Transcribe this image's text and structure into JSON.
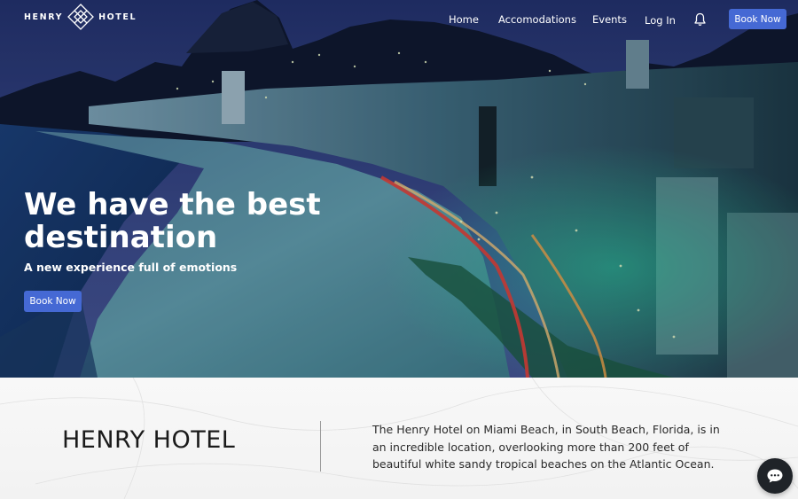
{
  "nav": {
    "logo_left": "HENRY",
    "logo_right": "HOTEL",
    "links": [
      "Home",
      "Accomodations",
      "Events",
      "Log In"
    ],
    "book_label": "Book Now"
  },
  "hero": {
    "title": "We have the best destination",
    "subtitle": "A new experience full of emotions",
    "book_label": "Book Now"
  },
  "about": {
    "title": "HENRY HOTEL",
    "text": "The Henry Hotel on Miami Beach, in South Beach, Florida, is in an incredible location, overlooking more than 200 feet of beautiful white sandy tropical beaches on the Atlantic Ocean."
  },
  "icons": {
    "logo": "diamond-logo-icon",
    "notifications": "bell-icon",
    "chat": "chat-bubble-icon"
  },
  "colors": {
    "accent": "#4569d4",
    "chat_bg": "#1f2328"
  }
}
